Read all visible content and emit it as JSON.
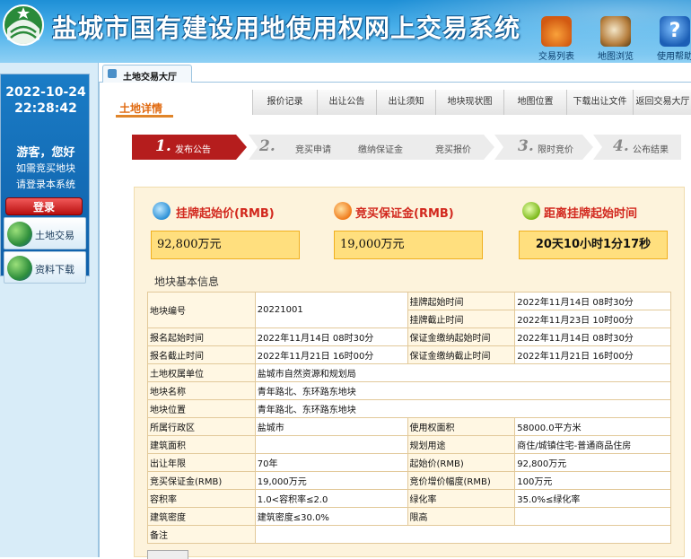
{
  "header": {
    "title": "盐城市国有建设用地使用权网上交易系统",
    "buttons": [
      {
        "label": "交易列表",
        "icon": "house-icon"
      },
      {
        "label": "地图浏览",
        "icon": "map-magnifier-icon"
      },
      {
        "label": "使用帮助",
        "icon": "help-icon"
      }
    ]
  },
  "sidebar": {
    "date": "2022-10-24",
    "time": "22:28:42",
    "welcome": "游客，您好",
    "need_bid": "如需竞买地块",
    "please_login": "请登录本系统",
    "login_label": "登录",
    "nav": [
      {
        "label": "土地交易"
      },
      {
        "label": "资料下载"
      }
    ]
  },
  "tab_strip": {
    "main_tab": "土地交易大厅"
  },
  "content": {
    "section_tab": "土地详情",
    "nav_items": [
      "报价记录",
      "出让公告",
      "出让须知",
      "地块现状图",
      "地图位置",
      "下载出让文件",
      "返回交易大厅"
    ],
    "steps": [
      {
        "num": "1.",
        "label": "发布公告",
        "active": true
      },
      {
        "num": "2.",
        "label": "竞买申请",
        "active": false
      },
      {
        "num": "",
        "label": "缴纳保证金",
        "active": false
      },
      {
        "num": "",
        "label": "竞买报价",
        "active": false
      },
      {
        "num": "3.",
        "label": "限时竞价",
        "active": false
      },
      {
        "num": "4.",
        "label": "公布结果",
        "active": false
      }
    ],
    "kpis": {
      "start_price_label": "挂牌起始价(RMB)",
      "start_price_value": "92,800万元",
      "deposit_label": "竞买保证金(RMB)",
      "deposit_value": "19,000万元",
      "countdown_label": "距离挂牌起始时间",
      "countdown_value": "20天10小时1分17秒"
    },
    "basic_title": "地块基本信息",
    "table": {
      "plot_no_k": "地块编号",
      "plot_no_v": "20221001",
      "list_start_k": "挂牌起始时间",
      "list_start_v": "2022年11月14日 08时30分",
      "list_end_k": "挂牌截止时间",
      "list_end_v": "2022年11月23日 10时00分",
      "reg_start_k": "报名起始时间",
      "reg_start_v": "2022年11月14日 08时30分",
      "dep_start_k": "保证金缴纳起始时间",
      "dep_start_v": "2022年11月14日 08时30分",
      "reg_end_k": "报名截止时间",
      "reg_end_v": "2022年11月21日 16时00分",
      "dep_end_k": "保证金缴纳截止时间",
      "dep_end_v": "2022年11月21日 16时00分",
      "owner_k": "土地权属单位",
      "owner_v": "盐城市自然资源和规划局",
      "name_k": "地块名称",
      "name_v": "青年路北、东环路东地块",
      "loc_k": "地块位置",
      "loc_v": "青年路北、东环路东地块",
      "district_k": "所属行政区",
      "district_v": "盐城市",
      "area_k": "使用权面积",
      "area_v": "58000.0平方米",
      "build_area_k": "建筑面积",
      "build_area_v": "",
      "use_k": "规划用途",
      "use_v": "商住/城镇住宅-普通商品住房",
      "term_k": "出让年限",
      "term_v": "70年",
      "price_k": "起始价(RMB)",
      "price_v": "92,800万元",
      "deposit_k": "竞买保证金(RMB)",
      "deposit_v": "19,000万元",
      "increment_k": "竞价增价幅度(RMB)",
      "increment_v": "100万元",
      "far_k": "容积率",
      "far_v": "1.0<容积率≤2.0",
      "green_k": "绿化率",
      "green_v": "35.0%≤绿化率",
      "density_k": "建筑密度",
      "density_v": "建筑密度≤30.0%",
      "height_k": "限高",
      "height_v": "",
      "remark_k": "备注",
      "remark_v": ""
    }
  }
}
